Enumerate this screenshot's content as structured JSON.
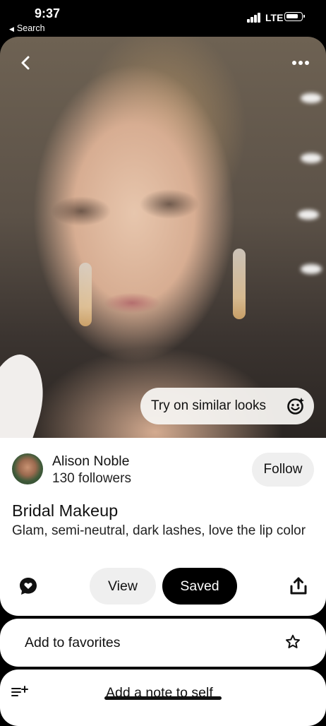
{
  "status_bar": {
    "time": "9:37",
    "back_app": "Search",
    "network": "LTE"
  },
  "photo": {
    "try_on_label": "Try on similar looks",
    "icons": [
      "back-chevron-icon",
      "more-options-icon",
      "face-smile-icon"
    ]
  },
  "pin": {
    "author_name": "Alison Noble",
    "followers": "130 followers",
    "follow_label": "Follow",
    "title": "Bridal Makeup",
    "description": "Glam, semi-neutral, dark lashes, love the lip color",
    "view_label": "View",
    "saved_label": "Saved"
  },
  "actions": {
    "favorites_label": "Add to favorites",
    "note_label": "Add a note to self"
  },
  "colors": {
    "saved_button": "#000000",
    "pill_button": "#efefef"
  }
}
